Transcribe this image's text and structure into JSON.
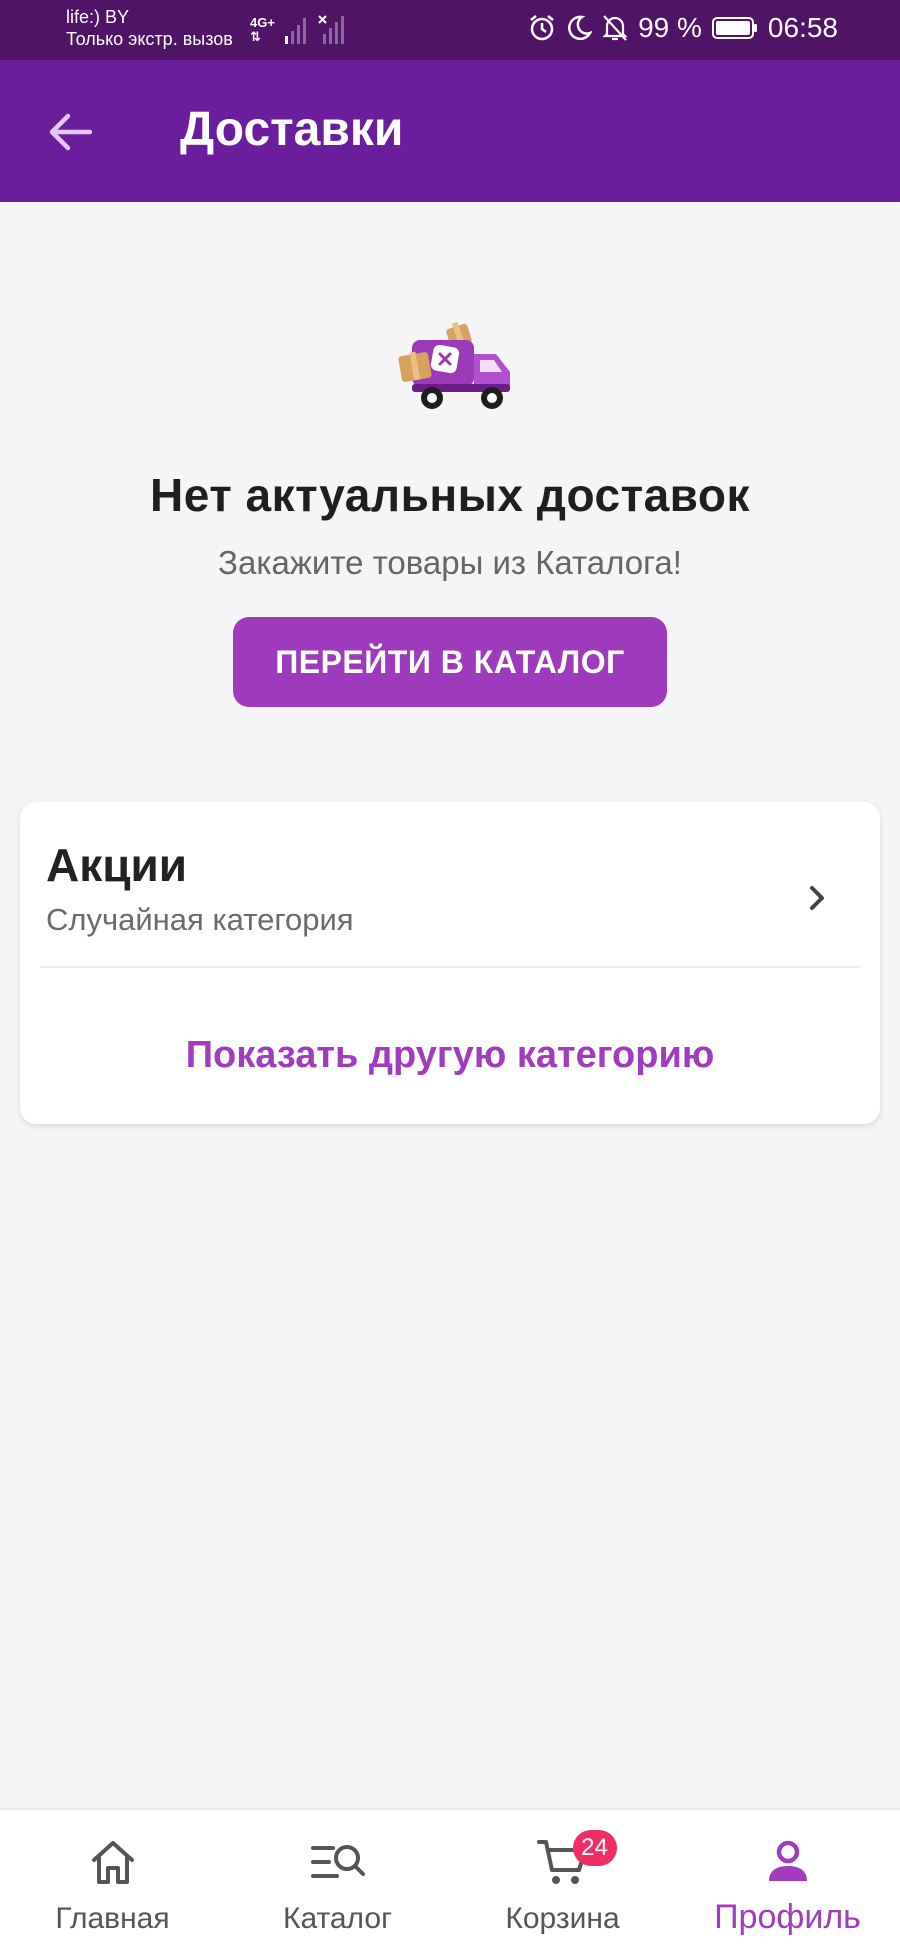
{
  "status_bar": {
    "carrier": "life:) BY",
    "carrier_note": "Только экстр. вызов",
    "network": "4G+",
    "battery_percent": "99 %",
    "time": "06:58"
  },
  "app_bar": {
    "title": "Доставки"
  },
  "empty_state": {
    "title": "Нет актуальных доставок",
    "subtitle": "Закажите товары из Каталога!",
    "button_label": "ПЕРЕЙТИ В КАТАЛОГ"
  },
  "category_card": {
    "title": "Акции",
    "subtitle": "Случайная категория",
    "link_label": "Показать другую категорию"
  },
  "bottom_nav": {
    "items": [
      {
        "label": "Главная",
        "icon": "home-icon"
      },
      {
        "label": "Каталог",
        "icon": "catalog-search-icon"
      },
      {
        "label": "Корзина",
        "icon": "cart-icon",
        "badge": "24"
      },
      {
        "label": "Профиль",
        "icon": "profile-icon",
        "active": true
      }
    ]
  },
  "colors": {
    "status_bar": "#4f1466",
    "app_bar": "#6b1e9c",
    "accent": "#9d3bbc",
    "badge": "#ef2d66"
  }
}
